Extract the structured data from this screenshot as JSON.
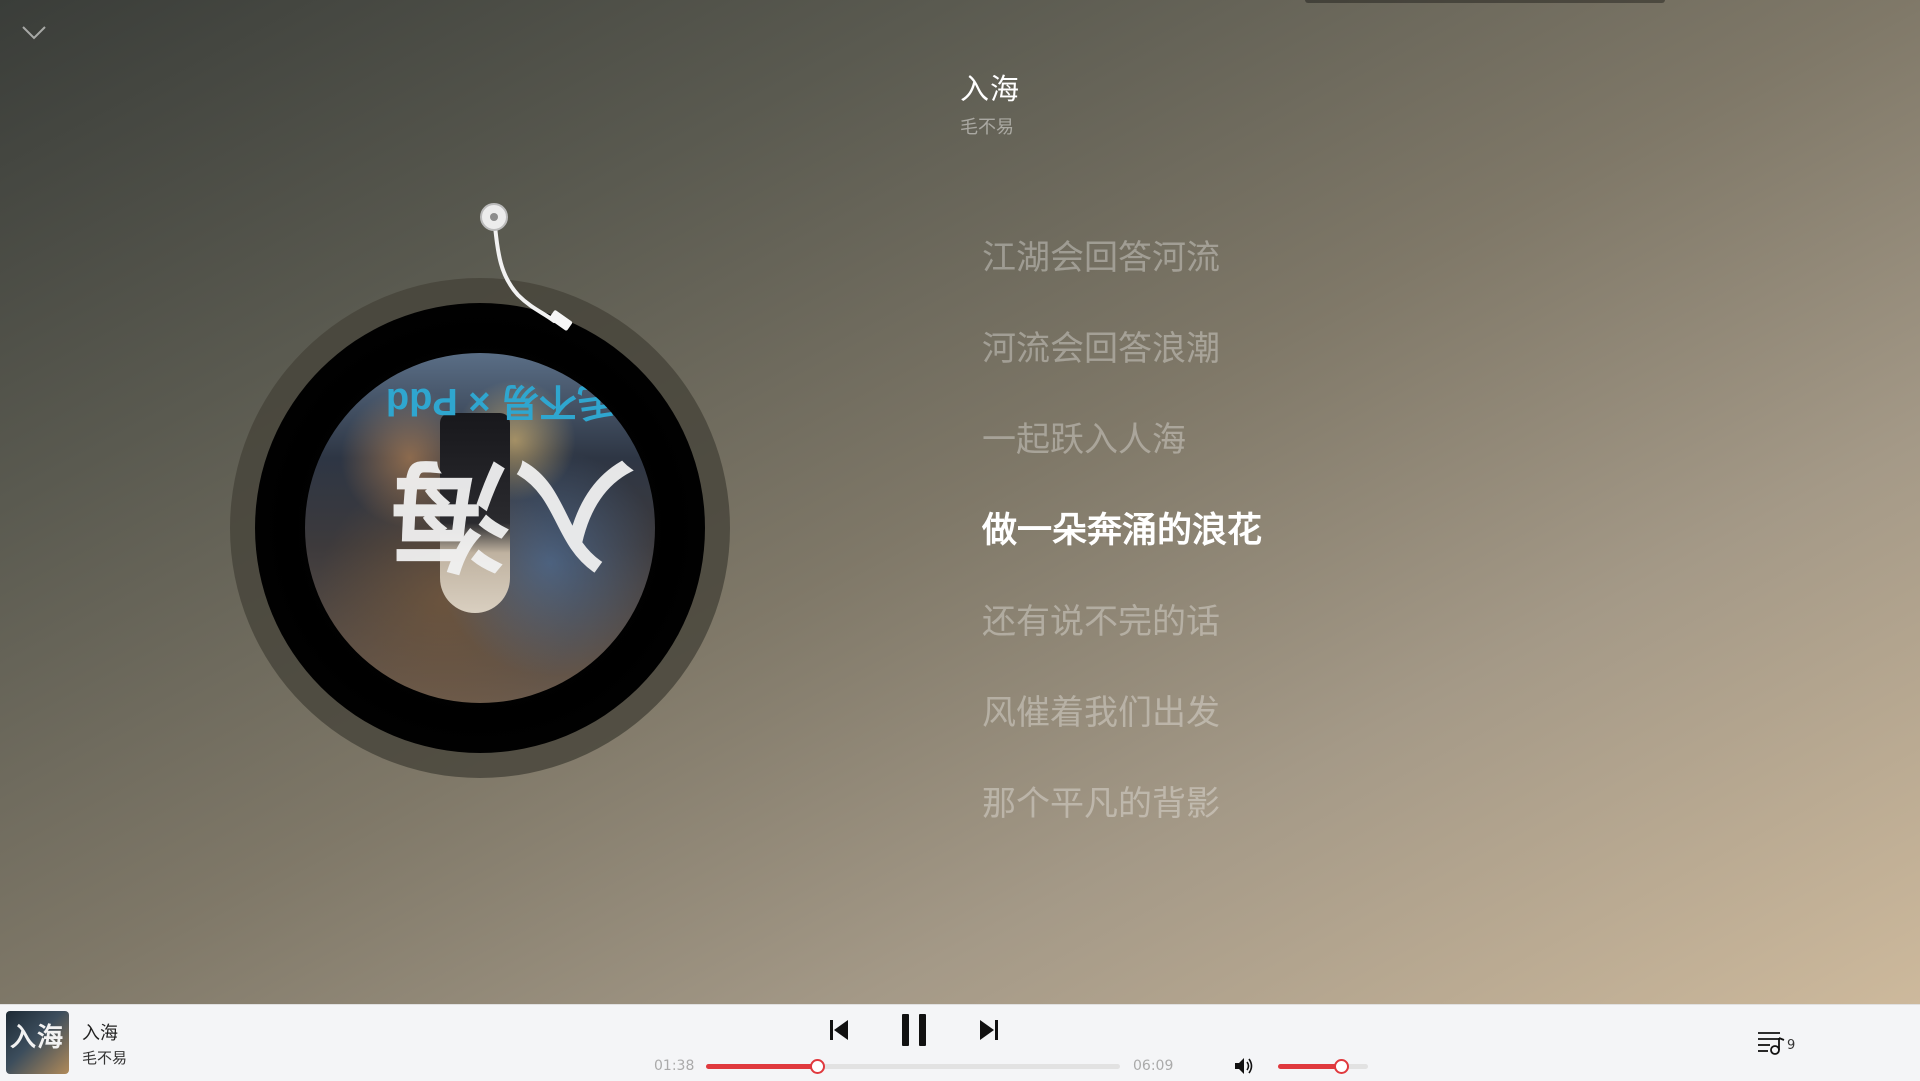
{
  "song": {
    "title": "入海",
    "artist": "毛不易"
  },
  "cover": {
    "big_text": "入海",
    "small_text": "毛不易 × Pdd"
  },
  "lyrics": [
    {
      "text": "江湖会回答河流",
      "active": false
    },
    {
      "text": "河流会回答浪潮",
      "active": false
    },
    {
      "text": "一起跃入人海",
      "active": false
    },
    {
      "text": "做一朵奔涌的浪花",
      "active": true
    },
    {
      "text": "还有说不完的话",
      "active": false
    },
    {
      "text": "风催着我们出发",
      "active": false
    },
    {
      "text": "那个平凡的背影",
      "active": false
    }
  ],
  "player": {
    "title": "入海",
    "artist": "毛不易",
    "mini_cover_text": "入海",
    "current_time": "01:38",
    "total_time": "06:09",
    "progress_fraction": 0.268,
    "volume_fraction": 0.7,
    "playlist_count": "9"
  },
  "colors": {
    "accent": "#e0393e",
    "bar_bg": "#f4f5f7"
  },
  "icons": {
    "collapse": "chevron-down-icon",
    "prev": "skip-previous-icon",
    "pause": "pause-icon",
    "next": "skip-next-icon",
    "volume": "volume-icon",
    "playlist": "playlist-icon"
  }
}
